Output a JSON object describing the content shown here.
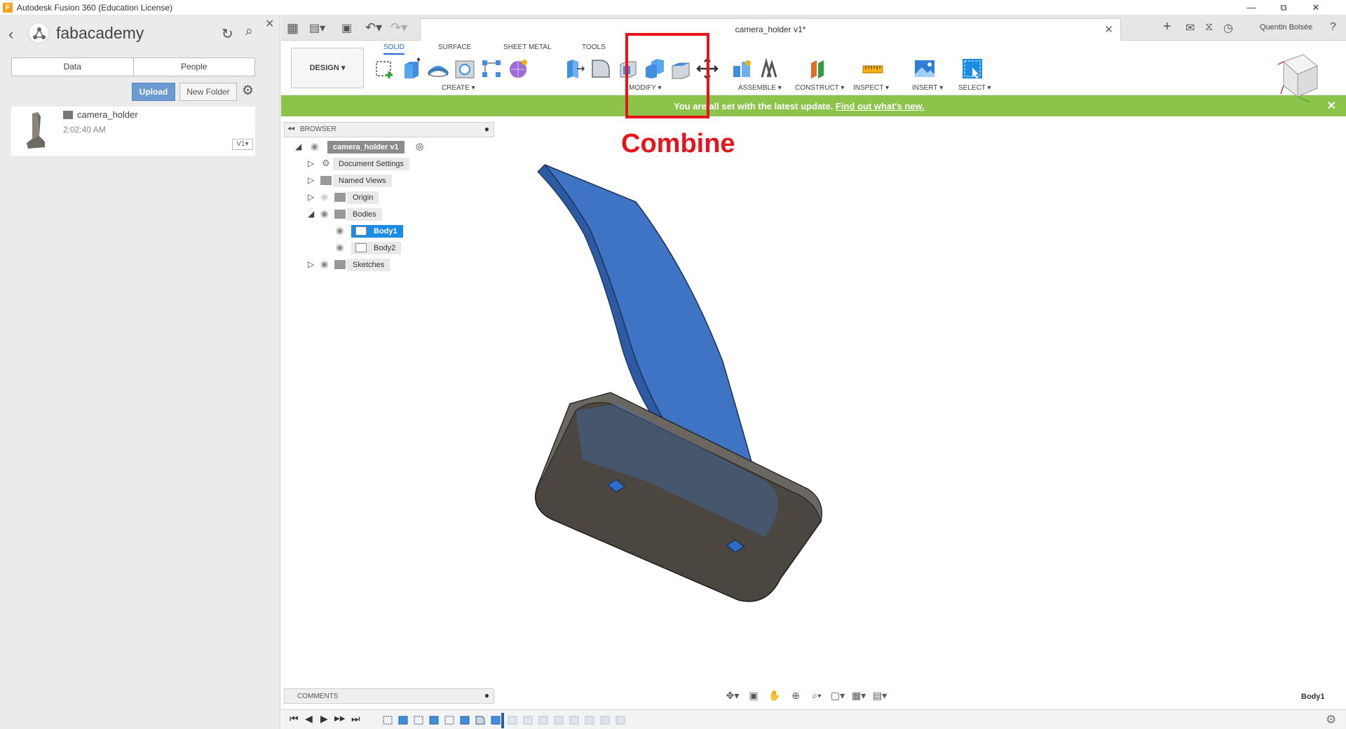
{
  "window": {
    "title": "Autodesk Fusion 360 (Education License)",
    "logo_letter": "F",
    "minimize": "—",
    "restore": "⧉",
    "close": "✕"
  },
  "data_panel": {
    "back": "‹",
    "title": "fabacademy",
    "refresh": "↻",
    "search": "⌕",
    "close": "✕",
    "tabs": [
      "Data",
      "People"
    ],
    "upload_label": "Upload",
    "new_folder_label": "New Folder",
    "gear": "⚙",
    "file": {
      "name": "camera_holder",
      "time": "2:02:40 AM",
      "version": "V1▾"
    }
  },
  "document": {
    "title": "camera_holder v1*",
    "close": "✕",
    "grid": "▦",
    "file": "▤▾",
    "save": "▣",
    "undo": "↶▾",
    "redo": "↷▾",
    "user": "Quentin Bolsée",
    "header_icons": {
      "add": "+",
      "chat": "✉",
      "history": "⧖",
      "help": "?",
      "user_clock": "◷"
    }
  },
  "toolbar": {
    "design": "DESIGN ▾",
    "workspace_tabs": [
      "SOLID",
      "SURFACE",
      "SHEET METAL",
      "TOOLS"
    ],
    "groups": [
      "CREATE ▾",
      "MODIFY ▾",
      "ASSEMBLE ▾",
      "CONSTRUCT ▾",
      "INSPECT ▾",
      "INSERT ▾",
      "SELECT ▾"
    ]
  },
  "banner": {
    "text_before": "You are all set with the latest update. ",
    "link": "Find out what's new.",
    "close": "✕"
  },
  "annotation": {
    "label": "Combine",
    "color": "#e8141b"
  },
  "browser": {
    "title": "BROWSER",
    "collapse": "◂◂",
    "pin": "●",
    "root": "camera_holder v1",
    "items": [
      {
        "label": "Document Settings"
      },
      {
        "label": "Named Views"
      },
      {
        "label": "Origin"
      },
      {
        "label": "Bodies"
      },
      {
        "label": "Body1"
      },
      {
        "label": "Body2"
      },
      {
        "label": "Sketches"
      }
    ]
  },
  "comments": {
    "title": "COMMENTS",
    "pin": "●"
  },
  "status": {
    "selection": "Body1"
  },
  "navbar": [
    "✥▾",
    "▣",
    "✋",
    "⊕",
    "⌕▾",
    "▢▾",
    "▦▾",
    "▤▾"
  ],
  "timeline": {
    "controls": [
      "⏮",
      "◀",
      "▶",
      "▶▶",
      "⏭"
    ],
    "settings": "⚙"
  },
  "colors": {
    "banner": "#8cc34a",
    "accent": "#1a6fcf",
    "body_blue": "#3f73c4",
    "body_dark": "#4b4740"
  }
}
